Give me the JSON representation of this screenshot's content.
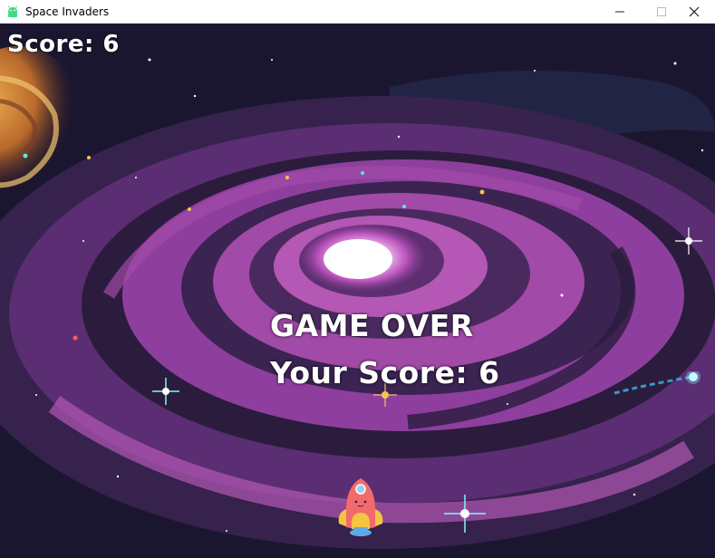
{
  "window": {
    "title": "Space Invaders",
    "app_icon": "android-icon",
    "controls": [
      "minimize-icon",
      "maximize-icon",
      "close-icon"
    ]
  },
  "hud": {
    "score_text": "Score: 6"
  },
  "game_over": {
    "title": "GAME OVER",
    "final_score_text": "Your Score: 6"
  },
  "colors": {
    "space": "#1b1630",
    "galaxy_purple": "#8e3f9e",
    "galaxy_core": "#f7d6f7",
    "nebula_orange": "#d98a3a",
    "ship_body": "#f26b6b",
    "ship_wing": "#f5c542",
    "ship_flame": "#5fa8e8"
  }
}
